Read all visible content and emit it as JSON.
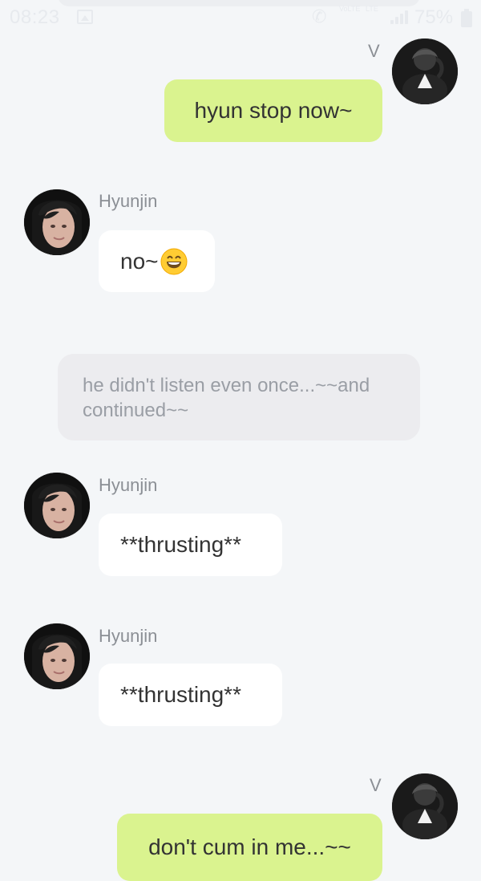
{
  "status_bar": {
    "time": "08:23",
    "network_primary": "VoLTE",
    "network_secondary": "LTE",
    "battery": "75%"
  },
  "messages": {
    "m1": {
      "sender": "V",
      "text": "hyun stop now~"
    },
    "m2": {
      "sender": "Hyunjin",
      "text": "no~"
    },
    "m3": {
      "text": "he didn't listen even once...~~and continued~~"
    },
    "m4": {
      "sender": "Hyunjin",
      "text": "**thrusting**"
    },
    "m5": {
      "sender": "Hyunjin",
      "text": "**thrusting**"
    },
    "m6": {
      "sender": "V",
      "text": "don't cum in me...~~"
    }
  },
  "colors": {
    "background": "#f4f6f8",
    "outgoing_bubble": "#daf38f",
    "incoming_bubble": "#ffffff",
    "narration_bubble": "#ececef",
    "sender_name": "#8b8f95"
  },
  "icons": {
    "call": "phone-icon",
    "image": "image-icon",
    "signal": "signal-icon",
    "battery": "battery-icon",
    "emoji": "grinning-face-emoji"
  }
}
